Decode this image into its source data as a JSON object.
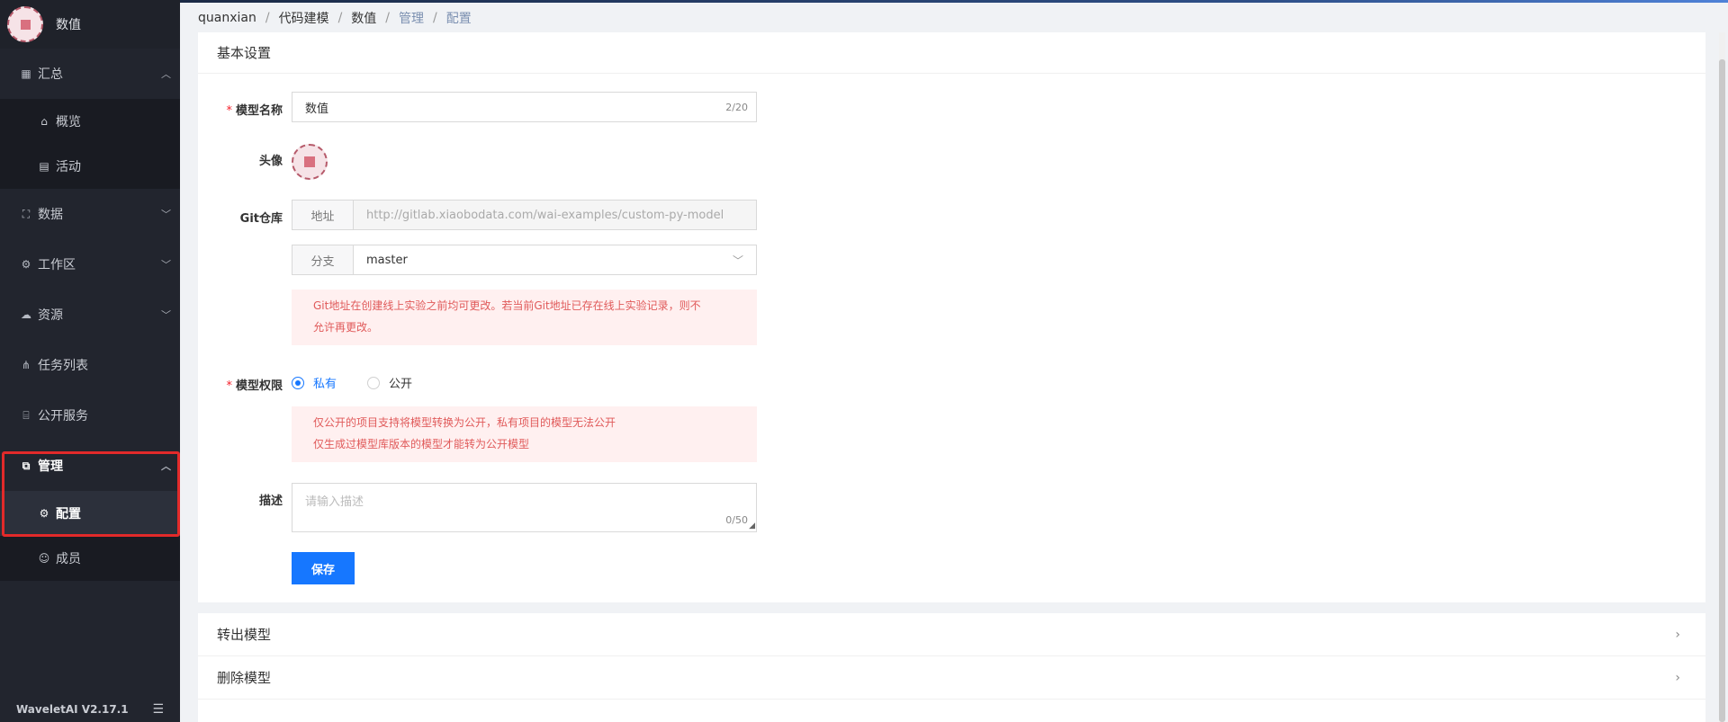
{
  "sidebar": {
    "project_name": "数值",
    "items": [
      {
        "label": "汇总",
        "icon": "grid-icon",
        "expanded": true,
        "children": [
          {
            "label": "概览",
            "icon": "home-icon"
          },
          {
            "label": "活动",
            "icon": "calendar-icon"
          }
        ]
      },
      {
        "label": "数据",
        "icon": "sitemap-icon"
      },
      {
        "label": "工作区",
        "icon": "settings-icon"
      },
      {
        "label": "资源",
        "icon": "cloud-icon"
      },
      {
        "label": "任务列表",
        "icon": "share-nodes-icon"
      },
      {
        "label": "公开服务",
        "icon": "storefront-icon"
      },
      {
        "label": "管理",
        "icon": "admin-icon",
        "expanded": true,
        "children": [
          {
            "label": "配置",
            "icon": "gear-icon",
            "active": true
          },
          {
            "label": "成员",
            "icon": "user-icon"
          }
        ]
      }
    ],
    "version": "WaveletAI V2.17.1"
  },
  "breadcrumb": [
    "quanxian",
    "代码建模",
    "数值",
    "管理",
    "配置"
  ],
  "form": {
    "section_title": "基本设置",
    "name_label": "模型名称",
    "name_value": "数值",
    "name_count": "2/20",
    "avatar_label": "头像",
    "git_label": "Git仓库",
    "addr_prefix": "地址",
    "addr_value": "http://gitlab.xiaobodata.com/wai-examples/custom-py-model",
    "branch_prefix": "分支",
    "branch_value": "master",
    "git_alert_line1": "Git地址在创建线上实验之前均可更改。若当前Git地址已存在线上实验记录，则不",
    "git_alert_line2": "允许再更改。",
    "perm_label": "模型权限",
    "perm_private": "私有",
    "perm_public": "公开",
    "perm_alert_line1": "仅公开的项目支持将模型转换为公开，私有项目的模型无法公开",
    "perm_alert_line2": "仅生成过模型库版本的模型才能转为公开模型",
    "desc_label": "描述",
    "desc_placeholder": "请输入描述",
    "desc_count": "0/50",
    "save_label": "保存"
  },
  "actions": {
    "export_label": "转出模型",
    "delete_label": "删除模型"
  },
  "colors": {
    "accent": "#1677ff",
    "sidebar_bg": "#22252e",
    "alert_bg": "#fff0f0",
    "alert_text": "#e05a5a",
    "highlight": "#e22a2a"
  }
}
